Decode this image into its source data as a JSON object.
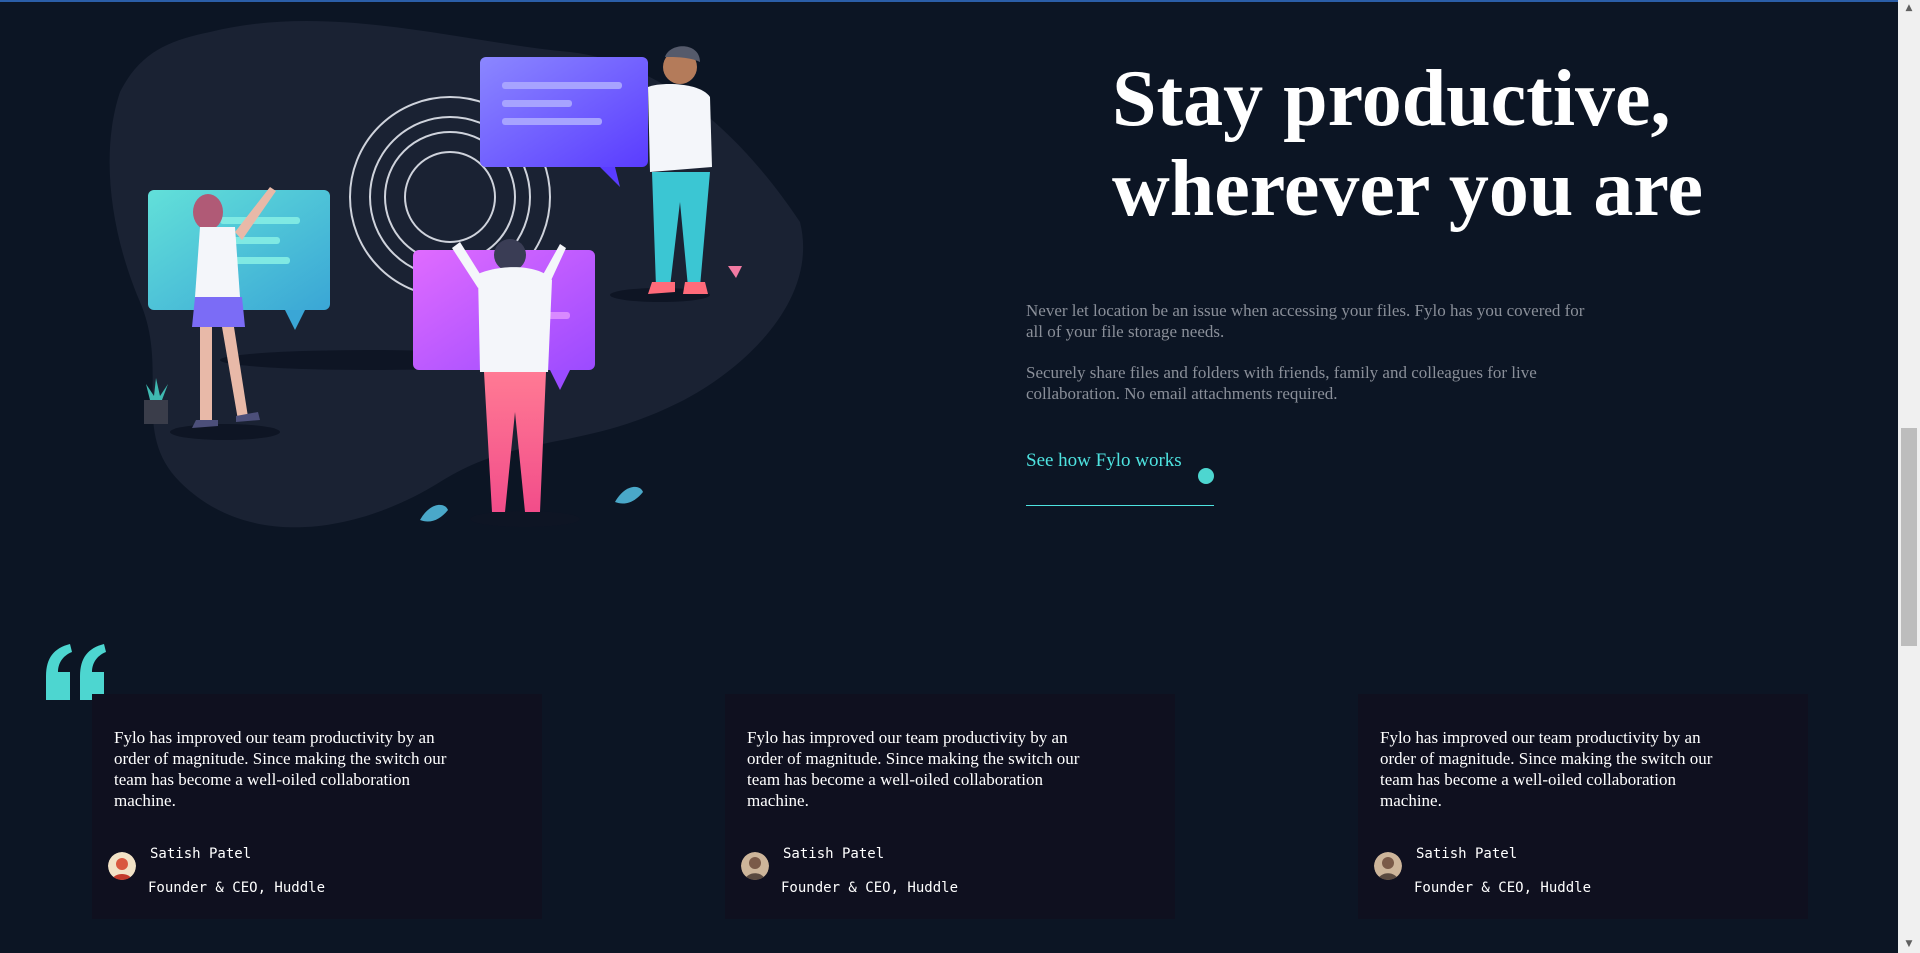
{
  "hero": {
    "title_line1": "Stay productive,",
    "title_line2": "wherever you are",
    "paragraph1": "Never let location be an issue when accessing your files. Fylo has you covered for all of your file storage needs.",
    "paragraph2": "Securely share files and folders with friends, family and colleagues for live collaboration. No email attachments required.",
    "cta_label": "See how Fylo works",
    "cta_icon": "arrow-dot-icon",
    "illustration": "productive-people-illustration"
  },
  "testimonials": [
    {
      "quote": "Fylo has improved our team productivity by an order of magnitude. Since making the switch our team has become a well-oiled collaboration machine.",
      "name": "Satish Patel",
      "role": "Founder & CEO, Huddle"
    },
    {
      "quote": "Fylo has improved our team productivity by an order of magnitude. Since making the switch our team has become a well-oiled collaboration machine.",
      "name": "Satish Patel",
      "role": "Founder & CEO, Huddle"
    },
    {
      "quote": "Fylo has improved our team productivity by an order of magnitude. Since making the switch our team has become a well-oiled collaboration machine.",
      "name": "Satish Patel",
      "role": "Founder & CEO, Huddle"
    }
  ],
  "colors": {
    "background": "#0c1524",
    "card_background": "#0f101f",
    "accent_cyan": "#4ee3e0",
    "body_text": "#8a8f99"
  },
  "scrollbar": {
    "up_icon": "scroll-up-arrow-icon",
    "down_icon": "scroll-down-arrow-icon"
  }
}
